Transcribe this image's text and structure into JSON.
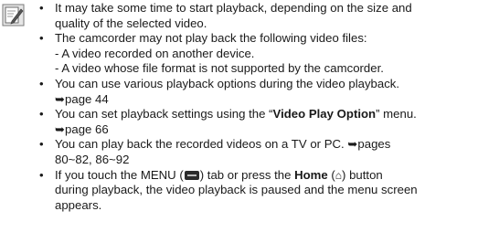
{
  "note_icon": "note-pencil-icon",
  "items": [
    {
      "lines": [
        "It may take some time to start playback, depending on the size and",
        "quality of the selected video."
      ]
    },
    {
      "lines": [
        "The camcorder may not play back the following video files:",
        "- A video recorded on another device.",
        "- A video whose file format is not supported by the camcorder."
      ]
    },
    {
      "lines": [
        "You can use various playback options during the video playback.",
        "➥page 44"
      ]
    },
    {
      "pre": "You can set playback settings using the “",
      "bold": "Video Play Option",
      "post": "” menu.",
      "ref": "➥page 66"
    },
    {
      "lines": [
        "You can play back the recorded videos on a TV or PC. ➥pages",
        "80~82, 86~92"
      ]
    },
    {
      "a": "If you touch the MENU (",
      "b": ") tab or press the ",
      "home": "Home",
      "c": " (",
      "home_glyph": "⌂",
      "d": ") button",
      "line2": "during playback, the video playback is paused and  the menu screen",
      "line3": "appears."
    }
  ]
}
